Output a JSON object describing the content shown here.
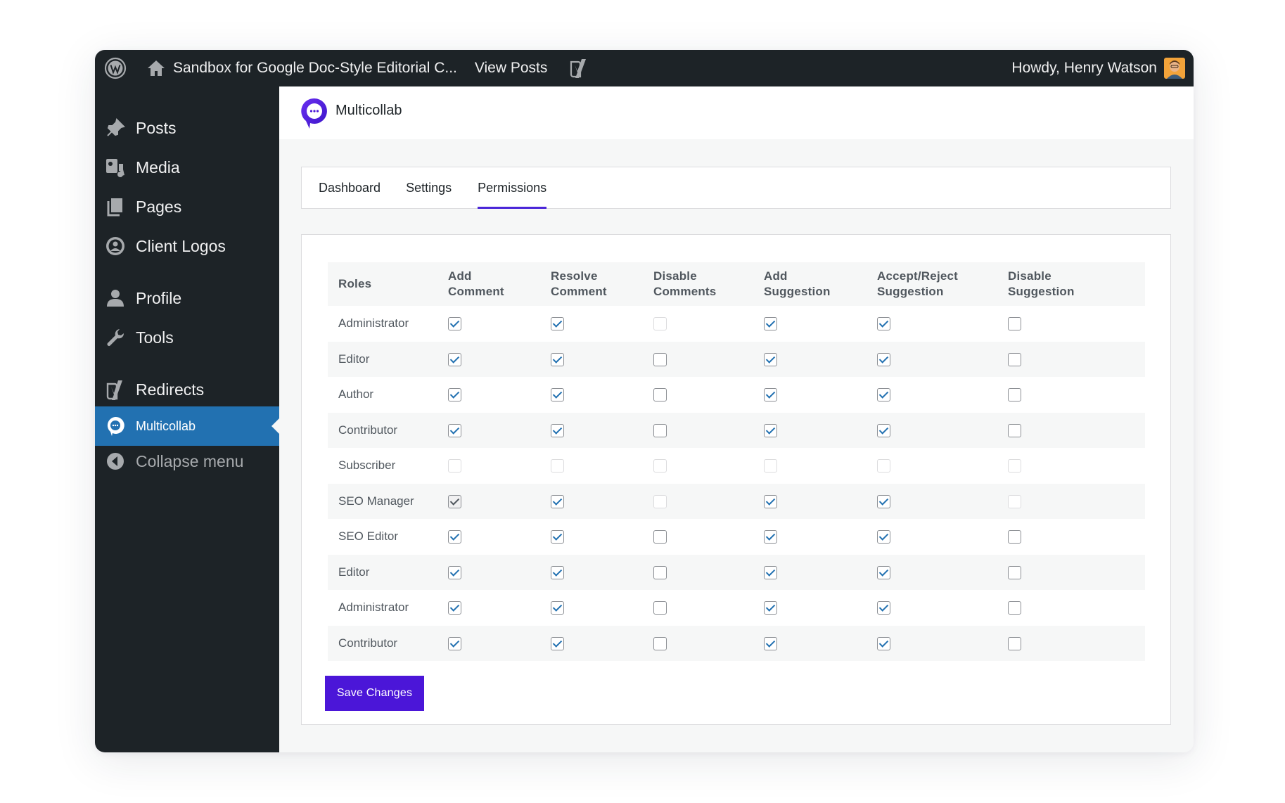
{
  "topbar": {
    "site_title": "Sandbox for Google Doc-Style Editorial C...",
    "view_posts": "View Posts",
    "howdy": "Howdy, Henry Watson"
  },
  "sidebar": {
    "items": [
      {
        "label": "Posts",
        "icon": "pushpin-icon"
      },
      {
        "label": "Media",
        "icon": "media-icon"
      },
      {
        "label": "Pages",
        "icon": "pages-icon"
      },
      {
        "label": "Client Logos",
        "icon": "client-logos-icon"
      },
      {
        "label": "Profile",
        "icon": "profile-icon"
      },
      {
        "label": "Tools",
        "icon": "wrench-icon"
      },
      {
        "label": "Redirects",
        "icon": "yoast-icon"
      },
      {
        "label": "Multicollab",
        "icon": "multicollab-icon",
        "active": true
      },
      {
        "label": "Collapse menu",
        "icon": "collapse-icon"
      }
    ]
  },
  "plugin": {
    "name": "Multicollab"
  },
  "tabs": [
    {
      "label": "Dashboard",
      "active": false
    },
    {
      "label": "Settings",
      "active": false
    },
    {
      "label": "Permissions",
      "active": true
    }
  ],
  "permissions": {
    "headers": {
      "roles": "Roles",
      "add_comment_1": "Add",
      "add_comment_2": "Comment",
      "resolve_comment_1": "Resolve",
      "resolve_comment_2": "Comment",
      "disable_comments_1": "Disable",
      "disable_comments_2": "Comments",
      "add_suggestion_1": "Add",
      "add_suggestion_2": "Suggestion",
      "accept_reject_1": "Accept/Reject",
      "accept_reject_2": "Suggestion",
      "disable_suggestion_1": "Disable",
      "disable_suggestion_2": "Suggestion"
    },
    "rows": [
      {
        "role": "Administrator",
        "cells": [
          {
            "checked": true,
            "disabled": false
          },
          {
            "checked": true,
            "disabled": false
          },
          {
            "checked": false,
            "disabled": true
          },
          {
            "checked": true,
            "disabled": false
          },
          {
            "checked": true,
            "disabled": false
          },
          {
            "checked": false,
            "disabled": false
          }
        ]
      },
      {
        "role": "Editor",
        "cells": [
          {
            "checked": true,
            "disabled": false
          },
          {
            "checked": true,
            "disabled": false
          },
          {
            "checked": false,
            "disabled": false
          },
          {
            "checked": true,
            "disabled": false
          },
          {
            "checked": true,
            "disabled": false
          },
          {
            "checked": false,
            "disabled": false
          }
        ]
      },
      {
        "role": "Author",
        "cells": [
          {
            "checked": true,
            "disabled": false
          },
          {
            "checked": true,
            "disabled": false
          },
          {
            "checked": false,
            "disabled": false
          },
          {
            "checked": true,
            "disabled": false
          },
          {
            "checked": true,
            "disabled": false
          },
          {
            "checked": false,
            "disabled": false
          }
        ]
      },
      {
        "role": "Contributor",
        "cells": [
          {
            "checked": true,
            "disabled": false
          },
          {
            "checked": true,
            "disabled": false
          },
          {
            "checked": false,
            "disabled": false
          },
          {
            "checked": true,
            "disabled": false
          },
          {
            "checked": true,
            "disabled": false
          },
          {
            "checked": false,
            "disabled": false
          }
        ]
      },
      {
        "role": "Subscriber",
        "cells": [
          {
            "checked": false,
            "disabled": true
          },
          {
            "checked": false,
            "disabled": true
          },
          {
            "checked": false,
            "disabled": true
          },
          {
            "checked": false,
            "disabled": true
          },
          {
            "checked": false,
            "disabled": true
          },
          {
            "checked": false,
            "disabled": true
          }
        ]
      },
      {
        "role": "SEO Manager",
        "cells": [
          {
            "checked": true,
            "disabled": false,
            "dark": true
          },
          {
            "checked": true,
            "disabled": false
          },
          {
            "checked": false,
            "disabled": true
          },
          {
            "checked": true,
            "disabled": false
          },
          {
            "checked": true,
            "disabled": false
          },
          {
            "checked": false,
            "disabled": true
          }
        ]
      },
      {
        "role": "SEO Editor",
        "cells": [
          {
            "checked": true,
            "disabled": false
          },
          {
            "checked": true,
            "disabled": false
          },
          {
            "checked": false,
            "disabled": false
          },
          {
            "checked": true,
            "disabled": false
          },
          {
            "checked": true,
            "disabled": false
          },
          {
            "checked": false,
            "disabled": false
          }
        ]
      },
      {
        "role": "Editor",
        "cells": [
          {
            "checked": true,
            "disabled": false
          },
          {
            "checked": true,
            "disabled": false
          },
          {
            "checked": false,
            "disabled": false
          },
          {
            "checked": true,
            "disabled": false
          },
          {
            "checked": true,
            "disabled": false
          },
          {
            "checked": false,
            "disabled": false
          }
        ]
      },
      {
        "role": "Administrator",
        "cells": [
          {
            "checked": true,
            "disabled": false
          },
          {
            "checked": true,
            "disabled": false
          },
          {
            "checked": false,
            "disabled": false
          },
          {
            "checked": true,
            "disabled": false
          },
          {
            "checked": true,
            "disabled": false
          },
          {
            "checked": false,
            "disabled": false
          }
        ]
      },
      {
        "role": "Contributor",
        "cells": [
          {
            "checked": true,
            "disabled": false
          },
          {
            "checked": true,
            "disabled": false
          },
          {
            "checked": false,
            "disabled": false
          },
          {
            "checked": true,
            "disabled": false
          },
          {
            "checked": true,
            "disabled": false
          },
          {
            "checked": false,
            "disabled": false
          }
        ]
      }
    ]
  },
  "save_label": "Save Changes",
  "colors": {
    "admin_bar": "#1d2327",
    "active_menu": "#2271b1",
    "brand_purple": "#4b16d8",
    "checkbox_blue": "#2271b1"
  }
}
